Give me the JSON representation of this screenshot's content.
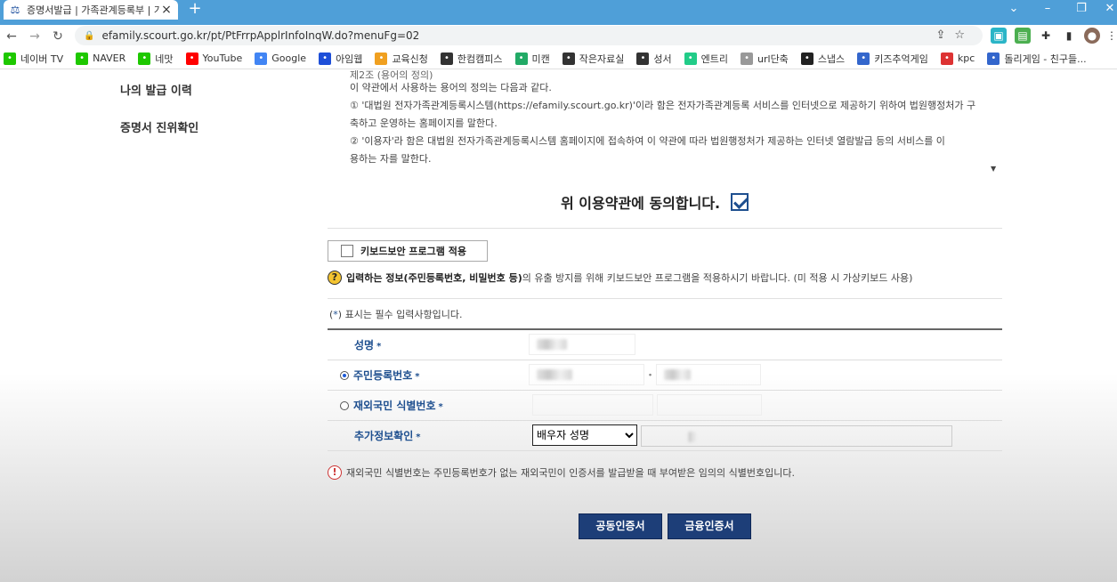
{
  "browser": {
    "tab_title": "증명서발급 | 가족관계등록부 | 가",
    "url": "efamily.scourt.go.kr/pt/PtFrrpApplrInfoInqW.do?menuFg=02",
    "new_tab": "+",
    "bookmarks": [
      {
        "label": "네이버 TV",
        "icon": "play-icon",
        "color": "#1ec800"
      },
      {
        "label": "NAVER",
        "icon": "naver-icon",
        "color": "#1ec800"
      },
      {
        "label": "네맛",
        "icon": "naver-icon",
        "color": "#1ec800"
      },
      {
        "label": "YouTube",
        "icon": "youtube-icon",
        "color": "#ff0000"
      },
      {
        "label": "Google",
        "icon": "google-icon",
        "color": "#4285f4"
      },
      {
        "label": "아임웹",
        "icon": "imweb-icon",
        "color": "#1e4fd8"
      },
      {
        "label": "교육신청",
        "icon": "edu-icon",
        "color": "#f0a020"
      },
      {
        "label": "한컴캠피스",
        "icon": "hancom-icon",
        "color": "#333333"
      },
      {
        "label": "미캔",
        "icon": "mican-icon",
        "color": "#22aa66"
      },
      {
        "label": "작은자료실",
        "icon": "dots-icon",
        "color": "#333333"
      },
      {
        "label": "성서",
        "icon": "bible-icon",
        "color": "#333333"
      },
      {
        "label": "엔트리",
        "icon": "entry-icon",
        "color": "#22cc88"
      },
      {
        "label": "url단축",
        "icon": "link-icon",
        "color": "#999999"
      },
      {
        "label": "스냅스",
        "icon": "snaps-icon",
        "color": "#222222"
      },
      {
        "label": "키즈추억게임",
        "icon": "kids-icon",
        "color": "#3366cc"
      },
      {
        "label": "kpc",
        "icon": "kpc-icon",
        "color": "#dd3333"
      },
      {
        "label": "돌리게임 - 친구들...",
        "icon": "dolly-icon",
        "color": "#3366cc"
      }
    ]
  },
  "sidebar": {
    "items": [
      "나의 발급 이력",
      "증명서 진위확인"
    ]
  },
  "terms": {
    "partial_top": "제2조 (용어의 정의)",
    "lines": [
      "이 약관에서 사용하는 용어의 정의는 다음과 같다.",
      "① '대법원 전자가족관계등록시스템(https://efamily.scourt.go.kr)'이라 함은 전자가족관계등록 서비스를 인터넷으로 제공하기 위하여 법원행정처가 구",
      "축하고 운영하는 홈페이지를 말한다.",
      "② '이용자'라 함은 대법원 전자가족관계등록시스템 홈페이지에 접속하여 이 약관에 따라 법원행정처가 제공하는 인터넷 열람발급 등의 서비스를 이",
      "용하는 자를 말한다."
    ]
  },
  "agree": {
    "label": "위 이용약관에 동의합니다.",
    "checked": true
  },
  "keyboard_security": {
    "label": "키보드보안 프로그램 적용"
  },
  "notice": {
    "bold": "입력하는 정보(주민등록번호, 비밀번호 등)",
    "rest": "의 유출 방지를 위해 키보드보안 프로그램을 적용하시기 바랍니다. (미 적용 시 가상키보드 사용)"
  },
  "required_note": {
    "prefix": "(",
    "star": "*",
    "suffix": ") 표시는 필수 입력사항입니다."
  },
  "form": {
    "star": "*",
    "name_label": "성명",
    "rrn_label": "주민등록번호",
    "foreign_label": "재외국민 식별번호",
    "extra_label": "추가정보확인",
    "extra_select_value": "배우자 성명"
  },
  "warning": {
    "text": "재외국민 식별번호는 주민등록번호가 없는 재외국민이 인증서를 발급받을 때 부여받은 임의의 식별번호입니다."
  },
  "buttons": {
    "public_cert": "공동인증서",
    "financial_cert": "금융인증서"
  },
  "colors": {
    "brand_navy": "#1d3e78",
    "label_blue": "#1e4f8f",
    "tabbar": "#4f9fd8"
  }
}
